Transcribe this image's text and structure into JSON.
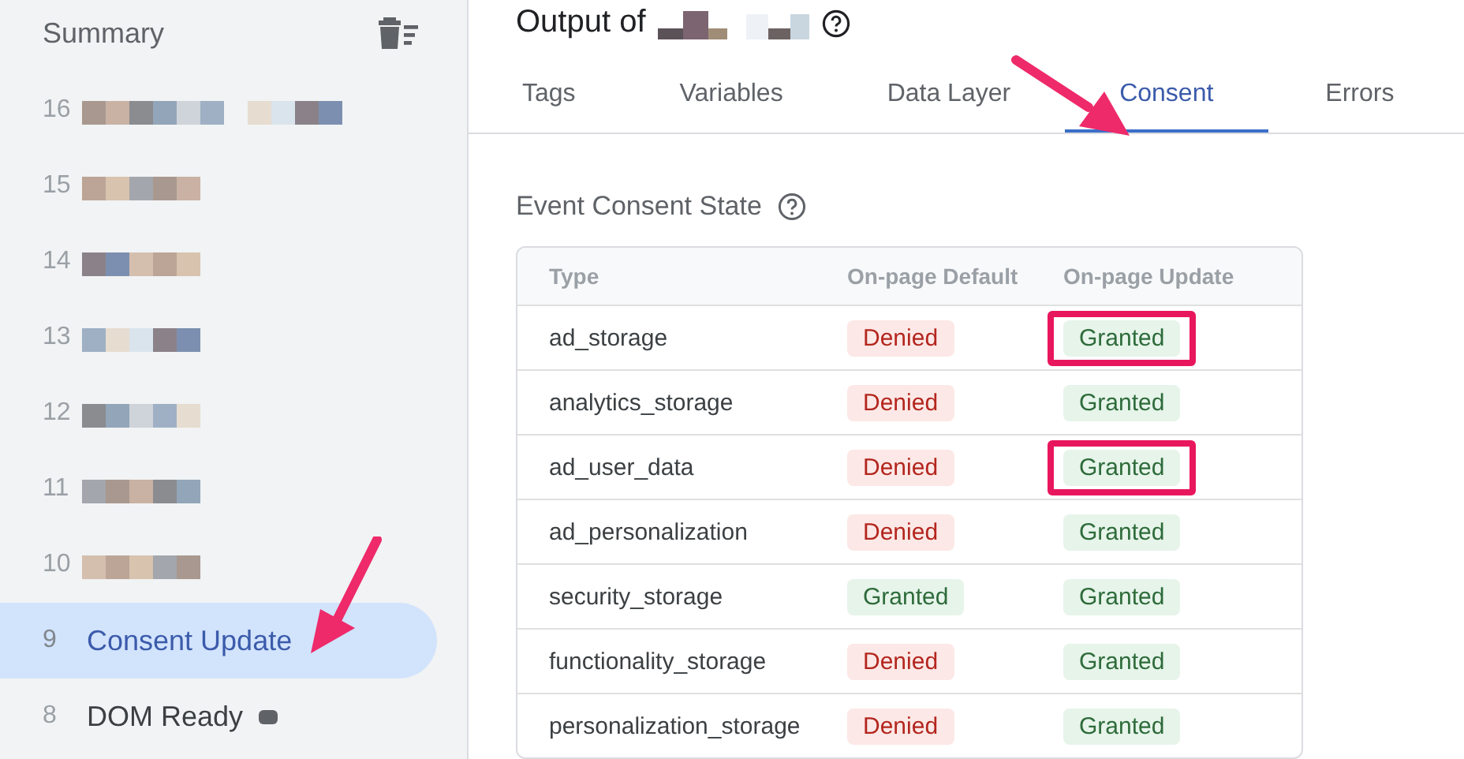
{
  "sidebar": {
    "title": "Summary",
    "items": [
      {
        "number": "16",
        "label_redacted": true,
        "selected": false
      },
      {
        "number": "15",
        "label_redacted": true,
        "selected": false
      },
      {
        "number": "14",
        "label_redacted": true,
        "selected": false
      },
      {
        "number": "13",
        "label_redacted": true,
        "selected": false
      },
      {
        "number": "12",
        "label_redacted": true,
        "selected": false
      },
      {
        "number": "11",
        "label_redacted": true,
        "selected": false
      },
      {
        "number": "10",
        "label_redacted": true,
        "selected": false
      },
      {
        "number": "9",
        "label": "Consent Update",
        "label_redacted": false,
        "selected": true
      },
      {
        "number": "8",
        "label": "DOM Ready",
        "label_redacted": false,
        "selected": false
      }
    ]
  },
  "header": {
    "title": "Output of",
    "title_redacted": true
  },
  "tabs": [
    {
      "label": "Tags",
      "selected": false
    },
    {
      "label": "Variables",
      "selected": false
    },
    {
      "label": "Data Layer",
      "selected": false
    },
    {
      "label": "Consent",
      "selected": true
    },
    {
      "label": "Errors",
      "selected": false
    }
  ],
  "section": {
    "title": "Event Consent State"
  },
  "table": {
    "columns": [
      "Type",
      "On-page Default",
      "On-page Update"
    ],
    "rows": [
      {
        "type": "ad_storage",
        "default": "Denied",
        "default_granted": false,
        "update": "Granted",
        "update_granted": true,
        "update_highlighted": true
      },
      {
        "type": "analytics_storage",
        "default": "Denied",
        "default_granted": false,
        "update": "Granted",
        "update_granted": true,
        "update_highlighted": false
      },
      {
        "type": "ad_user_data",
        "default": "Denied",
        "default_granted": false,
        "update": "Granted",
        "update_granted": true,
        "update_highlighted": true
      },
      {
        "type": "ad_personalization",
        "default": "Denied",
        "default_granted": false,
        "update": "Granted",
        "update_granted": true,
        "update_highlighted": false
      },
      {
        "type": "security_storage",
        "default": "Granted",
        "default_granted": true,
        "update": "Granted",
        "update_granted": true,
        "update_highlighted": false
      },
      {
        "type": "functionality_storage",
        "default": "Denied",
        "default_granted": false,
        "update": "Granted",
        "update_granted": true,
        "update_highlighted": false
      },
      {
        "type": "personalization_storage",
        "default": "Denied",
        "default_granted": false,
        "update": "Granted",
        "update_granted": true,
        "update_highlighted": false
      }
    ]
  }
}
